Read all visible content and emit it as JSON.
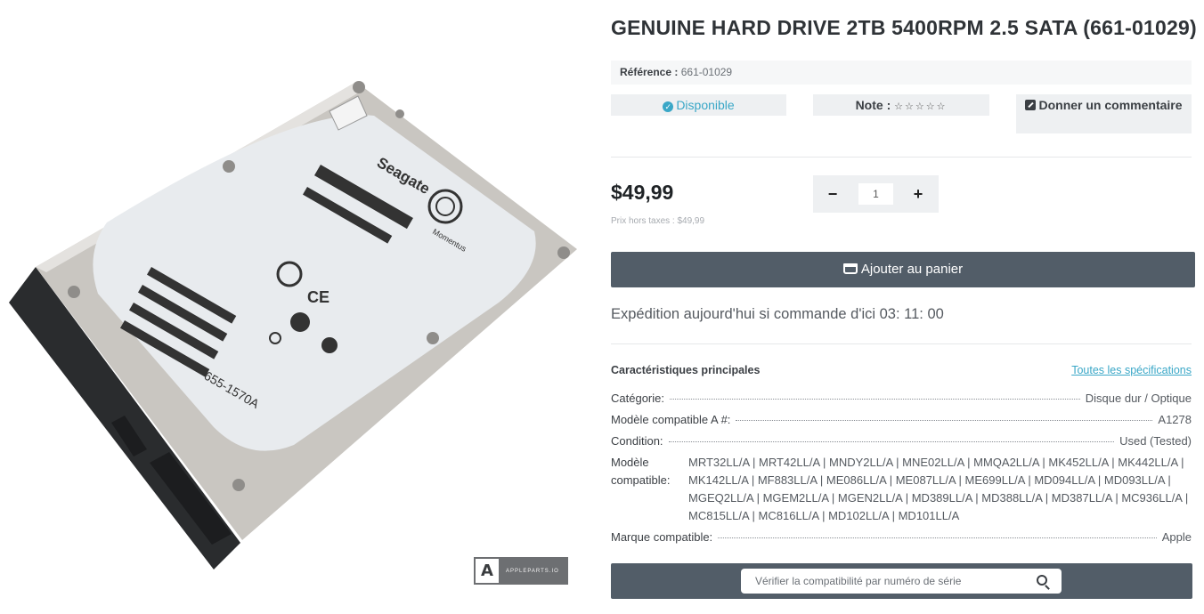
{
  "product": {
    "title": "GENUINE HARD DRIVE 2TB 5400RPM 2.5 SATA (661-01029)",
    "reference_label": "Référence :",
    "reference_value": "661-01029",
    "availability": "Disponible",
    "rating_label": "Note :",
    "rating_stars": "☆☆☆☆☆",
    "comment_label": "Donner un commentaire",
    "price": "$49,99",
    "price_ht": "Prix hors taxes : $49,99",
    "quantity": "1",
    "minus_label": "−",
    "plus_label": "+",
    "add_to_cart": "Ajouter au panier",
    "shipping_text": "Expédition aujourd'hui si commande d'ici 03: 11: 00"
  },
  "image": {
    "brand_logo_text": "APPLEPARTS.IO",
    "drive_brand": "Seagate",
    "drive_model": "655-1570A",
    "drive_line": "Momentus"
  },
  "specs": {
    "heading": "Caractéristiques principales",
    "all_link": "Toutes les spécifications",
    "rows": [
      {
        "label": "Catégorie:",
        "value": "Disque dur / Optique"
      },
      {
        "label": "Modèle compatible A #:",
        "value": "A1278"
      },
      {
        "label": "Condition:",
        "value": "Used (Tested)"
      }
    ],
    "compat_label": "Modèle compatible:",
    "compat_value": "MRT32LL/A | MRT42LL/A | MNDY2LL/A | MNE02LL/A | MMQA2LL/A | MK452LL/A | MK442LL/A | MK142LL/A | MF883LL/A | ME086LL/A | ME087LL/A | ME699LL/A | MD094LL/A | MD093LL/A | MGEQ2LL/A | MGEM2LL/A | MGEN2LL/A | MD389LL/A | MD388LL/A | MD387LL/A | MC936LL/A | MC815LL/A | MC816LL/A | MD102LL/A | MD101LL/A",
    "brand_label": "Marque compatible:",
    "brand_value": "Apple"
  },
  "serial_check": {
    "placeholder": "Vérifier la compatibilité par numéro de série"
  }
}
